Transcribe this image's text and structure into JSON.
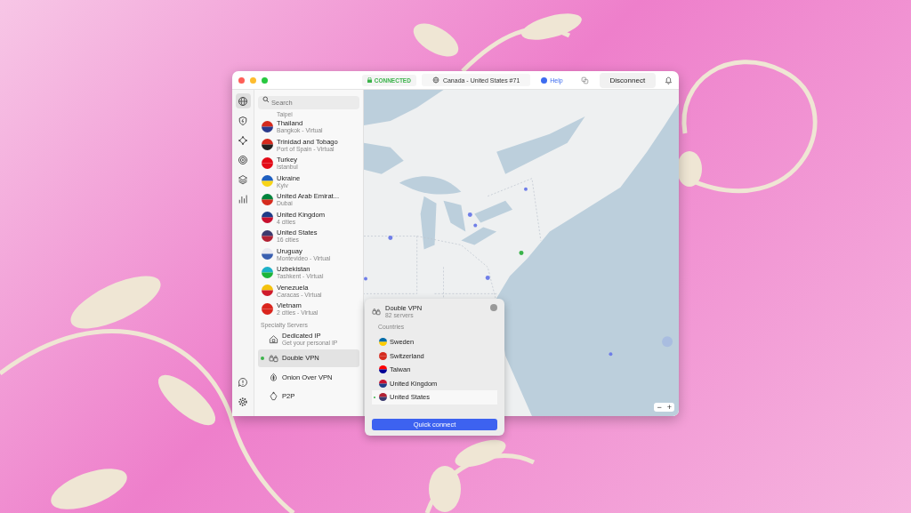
{
  "titlebar": {
    "status": "CONNECTED",
    "server": "Canada - United States #71",
    "help": "Help",
    "disconnect": "Disconnect"
  },
  "rail": [
    {
      "selected": true
    },
    {
      "selected": false
    },
    {
      "selected": false
    },
    {
      "selected": false
    },
    {
      "selected": false
    },
    {
      "selected": false
    }
  ],
  "search": {
    "placeholder": "Search"
  },
  "countries": [
    {
      "kind": "partial",
      "detail": "Taipei"
    },
    {
      "kind": "country",
      "name": "Thailand",
      "detail": "Bangkok - Virtual"
    },
    {
      "kind": "country",
      "name": "Trinidad and Tobago",
      "detail": "Port of Spain - Virtual"
    },
    {
      "kind": "country",
      "name": "Turkey",
      "detail": "Istanbul"
    },
    {
      "kind": "country",
      "name": "Ukraine",
      "detail": "Kyiv"
    },
    {
      "kind": "country",
      "name": "United Arab Emirat...",
      "detail": "Dubai"
    },
    {
      "kind": "country",
      "name": "United Kingdom",
      "detail": "4 cities"
    },
    {
      "kind": "country",
      "name": "United States",
      "detail": "16 cities"
    },
    {
      "kind": "country",
      "name": "Uruguay",
      "detail": "Montevideo - Virtual"
    },
    {
      "kind": "country",
      "name": "Uzbekistan",
      "detail": "Tashkent - Virtual"
    },
    {
      "kind": "country",
      "name": "Venezuela",
      "detail": "Caracas - Virtual"
    },
    {
      "kind": "country",
      "name": "Vietnam",
      "detail": "2 cities - Virtual"
    }
  ],
  "specialty": {
    "heading": "Specialty Servers",
    "items": [
      {
        "name": "Dedicated IP",
        "detail": "Get your personal IP",
        "selected": false
      },
      {
        "name": "Double VPN",
        "selected": true
      },
      {
        "name": "Onion Over VPN",
        "selected": false
      },
      {
        "name": "P2P",
        "selected": false
      }
    ]
  },
  "popup": {
    "title": "Double VPN",
    "detail": "82 servers",
    "section": "Countries",
    "countries": [
      {
        "name": "Sweden",
        "selected": false
      },
      {
        "name": "Switzerland",
        "selected": false
      },
      {
        "name": "Taiwan",
        "selected": false
      },
      {
        "name": "United Kingdom",
        "selected": false
      },
      {
        "name": "United States",
        "selected": true
      }
    ],
    "button": "Quick connect"
  },
  "zoom": {
    "minus": "−",
    "plus": "+"
  }
}
